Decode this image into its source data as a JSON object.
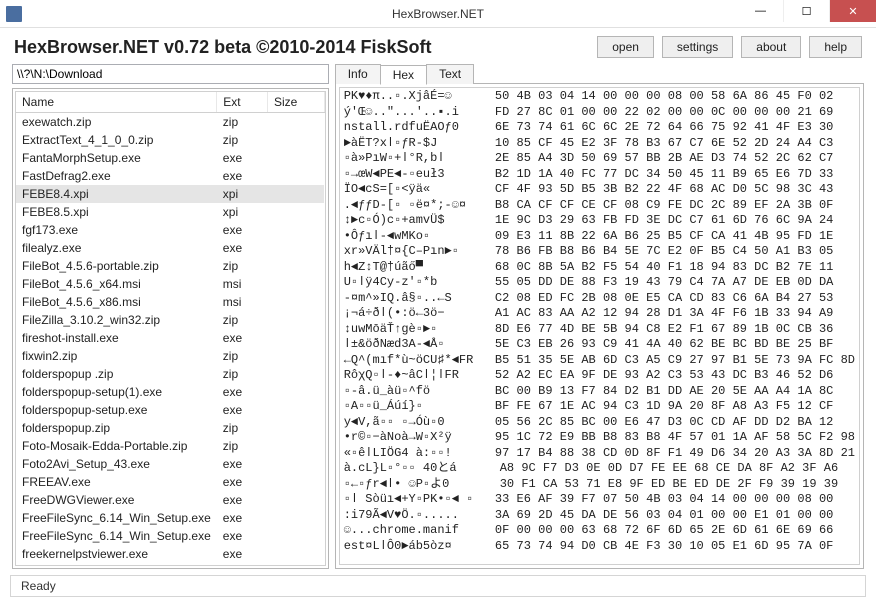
{
  "window": {
    "title": "HexBrowser.NET",
    "header": "HexBrowser.NET v0.72 beta  ©2010-2014 FiskSoft"
  },
  "buttons": {
    "open": "open",
    "settings": "settings",
    "about": "about",
    "help": "help"
  },
  "path": "\\\\?\\N:\\Download",
  "columns": {
    "name": "Name",
    "ext": "Ext",
    "size": "Size"
  },
  "files": [
    {
      "name": "exewatch.zip",
      "ext": "zip",
      "size": ""
    },
    {
      "name": "ExtractText_4_1_0_0.zip",
      "ext": "zip",
      "size": ""
    },
    {
      "name": "FantaMorphSetup.exe",
      "ext": "exe",
      "size": ""
    },
    {
      "name": "FastDefrag2.exe",
      "ext": "exe",
      "size": ""
    },
    {
      "name": "FEBE8.4.xpi",
      "ext": "xpi",
      "size": "",
      "selected": true
    },
    {
      "name": "FEBE8.5.xpi",
      "ext": "xpi",
      "size": ""
    },
    {
      "name": "fgf173.exe",
      "ext": "exe",
      "size": ""
    },
    {
      "name": "filealyz.exe",
      "ext": "exe",
      "size": ""
    },
    {
      "name": "FileBot_4.5.6-portable.zip",
      "ext": "zip",
      "size": ""
    },
    {
      "name": "FileBot_4.5.6_x64.msi",
      "ext": "msi",
      "size": ""
    },
    {
      "name": "FileBot_4.5.6_x86.msi",
      "ext": "msi",
      "size": ""
    },
    {
      "name": "FileZilla_3.10.2_win32.zip",
      "ext": "zip",
      "size": ""
    },
    {
      "name": "fireshot-install.exe",
      "ext": "exe",
      "size": ""
    },
    {
      "name": "fixwin2.zip",
      "ext": "zip",
      "size": ""
    },
    {
      "name": "folderspopup .zip",
      "ext": "zip",
      "size": ""
    },
    {
      "name": "folderspopup-setup(1).exe",
      "ext": "exe",
      "size": ""
    },
    {
      "name": "folderspopup-setup.exe",
      "ext": "exe",
      "size": ""
    },
    {
      "name": "folderspopup.zip",
      "ext": "zip",
      "size": ""
    },
    {
      "name": "Foto-Mosaik-Edda-Portable.zip",
      "ext": "zip",
      "size": ""
    },
    {
      "name": "Foto2Avi_Setup_43.exe",
      "ext": "exe",
      "size": ""
    },
    {
      "name": "FREEAV.exe",
      "ext": "exe",
      "size": ""
    },
    {
      "name": "FreeDWGViewer.exe",
      "ext": "exe",
      "size": ""
    },
    {
      "name": "FreeFileSync_6.14_Win_Setup.exe",
      "ext": "exe",
      "size": ""
    },
    {
      "name": "FreeFileSync_6.14_Win_Setup.exe",
      "ext": "exe",
      "size": ""
    },
    {
      "name": "freekernelpstviewer.exe",
      "ext": "exe",
      "size": ""
    }
  ],
  "tabs": {
    "info": "Info",
    "hex": "Hex",
    "text": "Text"
  },
  "hex_rows": [
    {
      "asc": "PK♥♦π..▫.XjâÉ=☺",
      "hex": "50 4B 03 04 14 00 00 00 08 00 58 6A 86 45 F0 02"
    },
    {
      "asc": "ý'Œ☺..\"...'..▪.i",
      "hex": "FD 27 8C 01 00 00 22 02 00 00 0C 00 00 00 21 69"
    },
    {
      "asc": "nstall.rdfuËAOƒ0",
      "hex": "6E 73 74 61 6C 6C 2E 72 64 66 75 92 41 4F E3 30"
    },
    {
      "asc": "►àËT?xǀ▫ƒR-$J",
      "hex": "10 85 CF 45 E2 3F 78 B3 67 C7 6E 52 2D 24 A4 C3"
    },
    {
      "asc": "▫à»PıW▫+ǀ°R,bǀ",
      "hex": "2E 85 A4 3D 50 69 57 BB 2B AE D3 74 52 2C 62 C7"
    },
    {
      "asc": "▫→œW◄PE◄-▫euł3",
      "hex": "B2 1D 1A 40 FC 77 DC 34 50 45 11 B9 65 E6 7D 33"
    },
    {
      "asc": "ÏO◄cS=[▫<ÿä«",
      "hex": "CF 4F 93 5D B5 3B B2 22 4F 68 AC D0 5C 98 3C 43"
    },
    {
      "asc": ".◄ƒƒD-[▫ ▫ë¤*;-☺¤",
      "hex": "B8 CA CF CF CE CF 08 C9 FE DC 2C 89 EF 2A 3B 0F"
    },
    {
      "asc": "↕►c▫Ó)c▫+amvÜ$",
      "hex": "1E 9C D3 29 63 FB FD 3E DC C7 61 6D 76 6C 9A 24"
    },
    {
      "asc": "•Ôƒıǀ-◄wMKo▫",
      "hex": "09 E3 11 8B 22 6A B6 25 B5 CF CA 41 4B 95 FD 1E"
    },
    {
      "asc": "xr»VÄl†¤{C–Pın►▫",
      "hex": "78 B6 FB B8 B6 B4 5E 7C E2 0F B5 C4 50 A1 B3 05"
    },
    {
      "asc": "h◄Z↕T@†úãő▀",
      "hex": "68 0C 8B 5A B2 F5 54 40 F1 18 94 83 DC B2 7E 11"
    },
    {
      "asc": "U▫ǀÿ4Cy-z'▫*b",
      "hex": "55 05 DD DE 88 F3 19 43 79 C4 7A A7 DE EB 0D DA"
    },
    {
      "asc": "-¤m^»IQ.â§▫..←S",
      "hex": "C2 08 ED FC 2B 08 0E E5 CA CD 83 C6 6A B4 27 53"
    },
    {
      "asc": "¡¬á÷ðǀ(•:ö←3ö−",
      "hex": "A1 AC 83 AA A2 12 94 28 D1 3A 4F F6 1B 33 94 A9"
    },
    {
      "asc": "↕uwMōäŤ↑gè▫►▫",
      "hex": "8D E6 77 4D BE 5B 94 C8 E2 F1 67 89 1B 0C CB 36"
    },
    {
      "asc": "ǀ±&öðNæd3A-◄Å▫",
      "hex": "5E C3 EB 26 93 C9 41 4A 40 62 BE BC BD BE 25 BF"
    },
    {
      "asc": "←Q^(mıf*ù~öCU♯*◄FR",
      "hex": "B5 51 35 5E AB 6D C3 A5 C9 27 97 B1 5E 73 9A FC 8D"
    },
    {
      "asc": "RôχQ▫ǀ-♦~âCǀ¦ǀFR",
      "hex": "52 A2 EC EA 9F DE 93 A2 C3 53 43 DC B3 46 52 D6"
    },
    {
      "asc": "▫-â.ü_àü▫^fö",
      "hex": "BC 00 B9 13 F7 84 D2 B1 DD AE 20 5E AA A4 1A 8C"
    },
    {
      "asc": "▫А▫▫ü_Áúí}▫",
      "hex": "BF FE 67 1E AC 94 C3 1D 9A 20 8F A8 A3 F5 12 CF"
    },
    {
      "asc": "y◄V,ã▫▫ ▫→Óù▫0",
      "hex": "05 56 2C 85 BC 00 E6 47 D3 0C CD AF DD D2 BA 12"
    },
    {
      "asc": "•r©▫−àNoà→W▫X²ÿ",
      "hex": "95 1C 72 E9 BB B8 83 B8 4F 57 01 1A AF 58 5C F2 98"
    },
    {
      "asc": "«▫êǀLIÖG4 à:▫▫!",
      "hex": "97 17 B4 88 38 CD 0D 8F F1 49 D6 34 20 A3 3A 8D 21"
    },
    {
      "asc": "à.cL}L▫°▫▫ 40とá",
      "hex": "A8 9C F7 D3 0E 0D D7 FE EE 68 CE DA 8F A2 3F A6"
    },
    {
      "asc": "▫←▫ƒr◄ǀ• ☺P▫よ0",
      "hex": "30 F1 CA 53 71 E8 9F ED BE ED DE 2F F9 39 19 39"
    },
    {
      "asc": "▫ǀ Sòüı◄+Y▫PK•▫◄ ▫",
      "hex": "33 E6 AF 39 F7 07 50 4B 03 04 14 00 00 00 08 00"
    },
    {
      "asc": ":i79Ã◄V♥Ö.▫.....",
      "hex": "3A 69 2D 45 DA DE 56 03 04 01 00 00 E1 01 00 00"
    },
    {
      "asc": "☺...chrome.manif",
      "hex": "0F 00 00 00 63 68 72 6F 6D 65 2E 6D 61 6E 69 66"
    },
    {
      "asc": "est¤LǀÔ0►áb5òz¤",
      "hex": "65 73 74 94 D0 CB 4E F3 30 10 05 E1 6D 95 7A 0F"
    }
  ],
  "status": "Ready"
}
